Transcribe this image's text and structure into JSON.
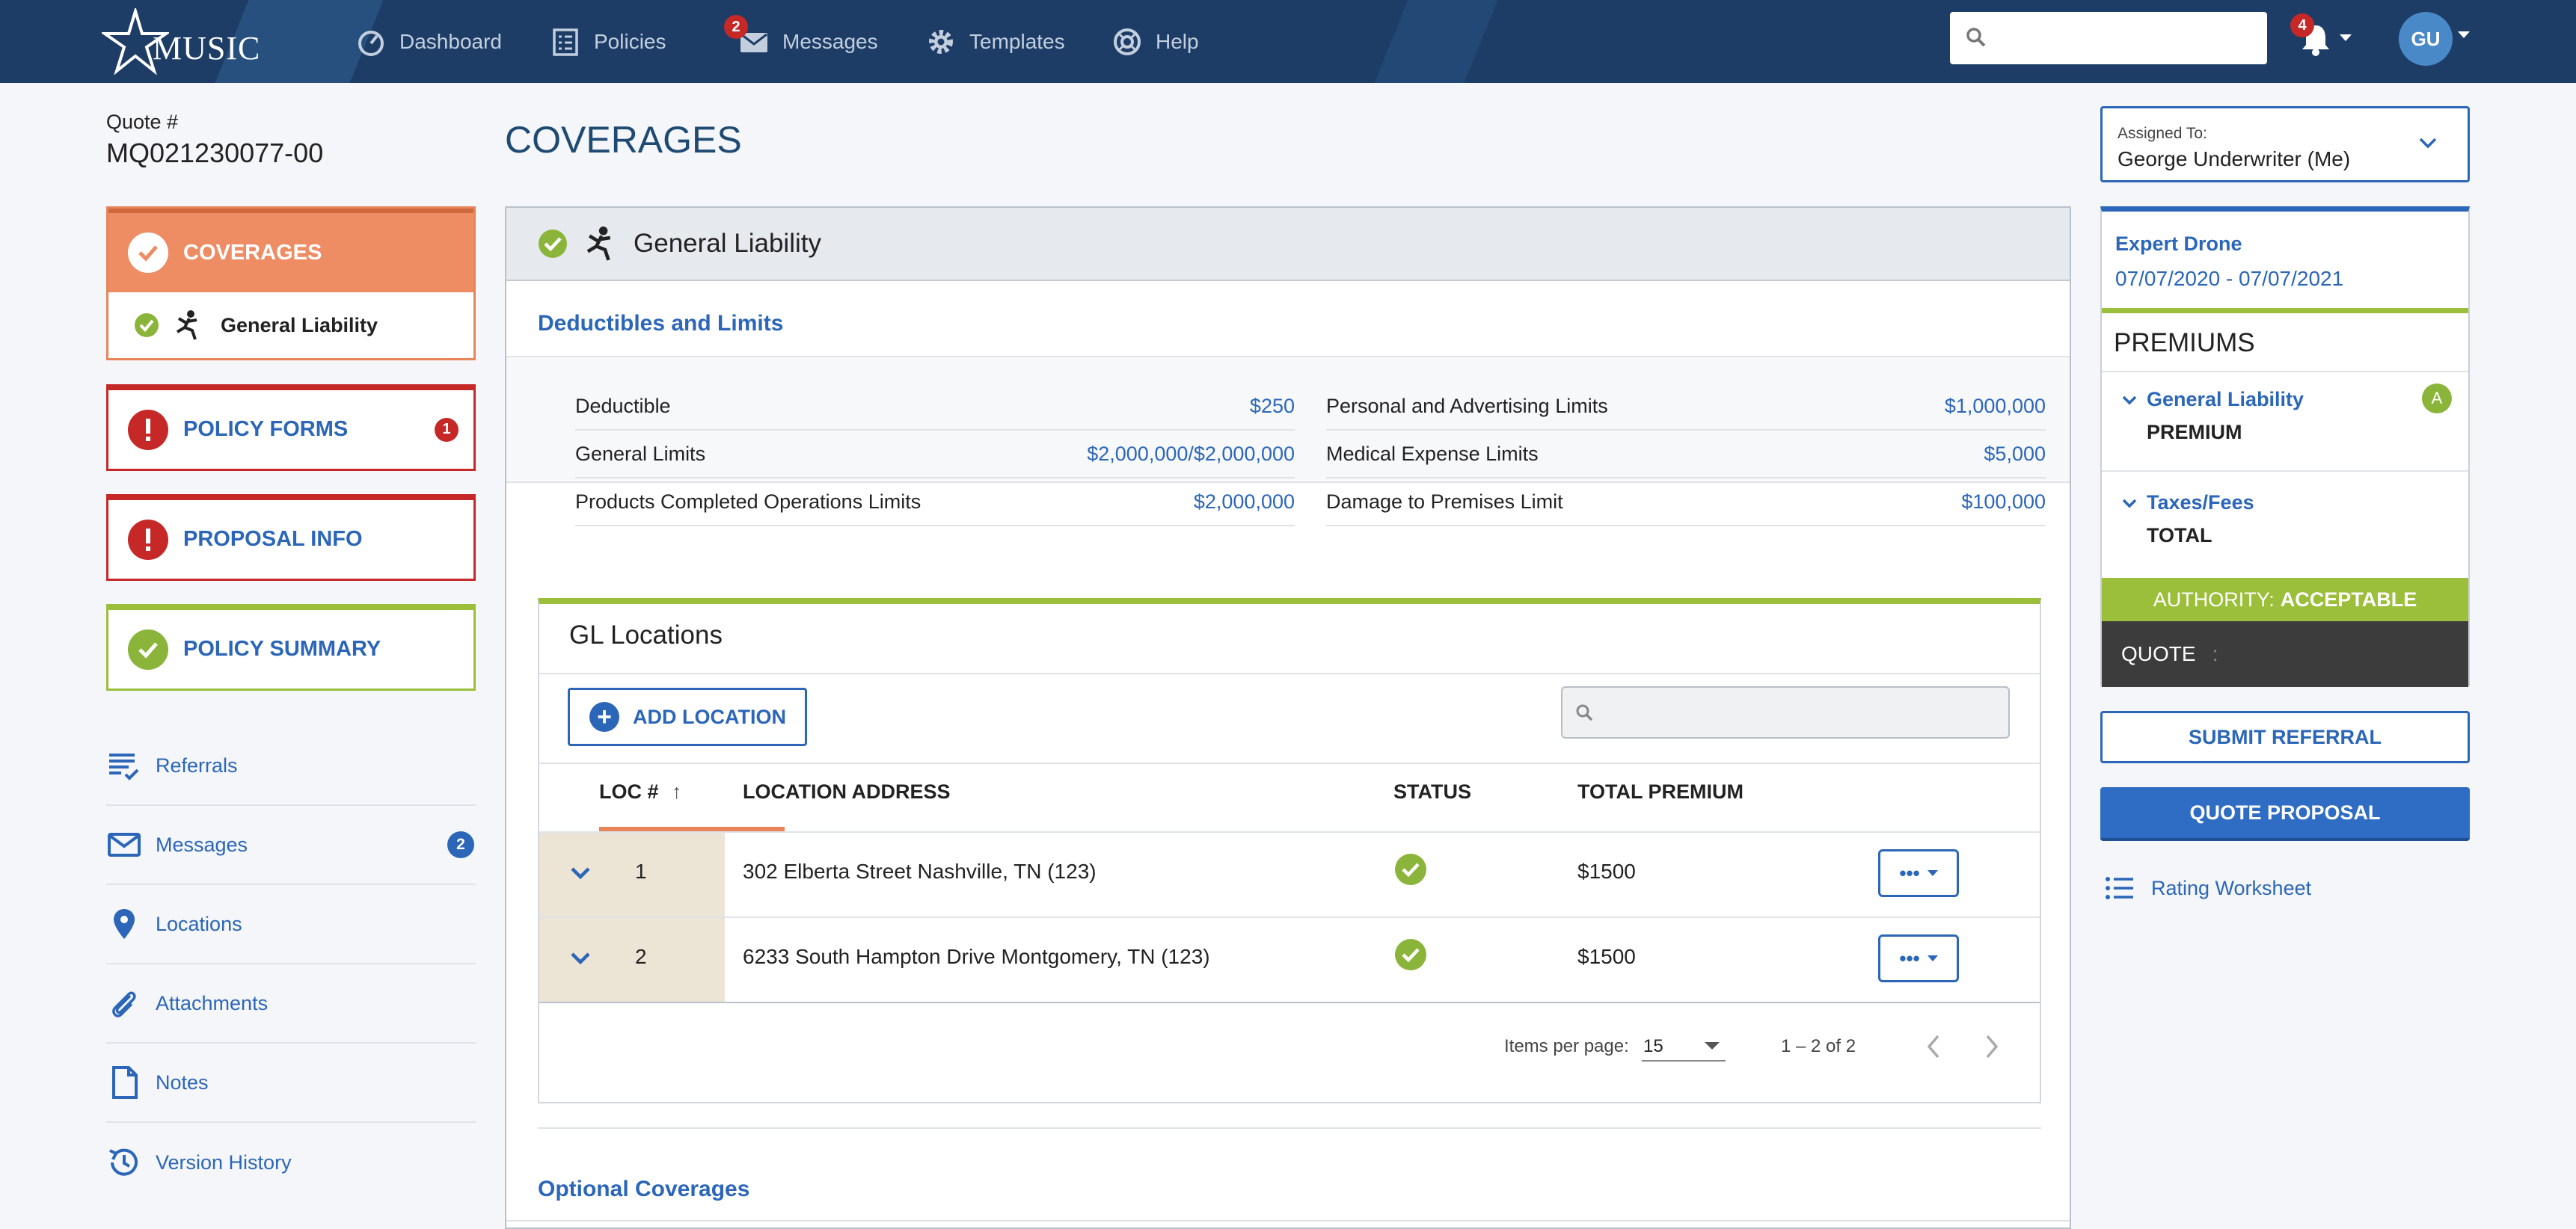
{
  "nav": {
    "logo": "MUSIC",
    "items": [
      {
        "label": "Dashboard",
        "icon": "dashboard-icon"
      },
      {
        "label": "Policies",
        "icon": "policies-icon"
      },
      {
        "label": "Messages",
        "icon": "messages-icon",
        "badge": "2"
      },
      {
        "label": "Templates",
        "icon": "gear-icon"
      },
      {
        "label": "Help",
        "icon": "help-icon"
      }
    ],
    "search_placeholder": "",
    "notification_count": "4",
    "user_initials": "GU"
  },
  "quote": {
    "label": "Quote #",
    "number": "MQ021230077-00"
  },
  "sidebar": {
    "coverages": {
      "label": "COVERAGES",
      "sub_label": "General Liability"
    },
    "policy_forms": {
      "label": "POLICY FORMS",
      "badge": "1"
    },
    "proposal_info": {
      "label": "PROPOSAL INFO"
    },
    "policy_summary": {
      "label": "POLICY SUMMARY"
    },
    "links": [
      {
        "label": "Referrals",
        "icon": "referrals-icon"
      },
      {
        "label": "Messages",
        "icon": "mail-icon",
        "badge": "2"
      },
      {
        "label": "Locations",
        "icon": "location-pin-icon"
      },
      {
        "label": "Attachments",
        "icon": "paperclip-icon"
      },
      {
        "label": "Notes",
        "icon": "document-icon"
      },
      {
        "label": "Version History",
        "icon": "history-icon"
      }
    ]
  },
  "main": {
    "title": "COVERAGES",
    "coverage_name": "General Liability",
    "deductibles_title": "Deductibles and Limits",
    "deductibles_left": [
      {
        "label": "Deductible",
        "value": "$250"
      },
      {
        "label": "General Limits",
        "value": "$2,000,000/$2,000,000"
      },
      {
        "label": "Products Completed Operations Limits",
        "value": "$2,000,000"
      }
    ],
    "deductibles_right": [
      {
        "label": "Personal and Advertising Limits",
        "value": "$1,000,000"
      },
      {
        "label": "Medical Expense Limits",
        "value": "$5,000"
      },
      {
        "label": "Damage to Premises Limit",
        "value": "$100,000"
      }
    ],
    "locations": {
      "title": "GL Locations",
      "add_button": "ADD LOCATION",
      "search_placeholder": "",
      "columns": [
        "LOC #",
        "LOCATION ADDRESS",
        "STATUS",
        "TOTAL PREMIUM"
      ],
      "rows": [
        {
          "loc": "1",
          "address": "302 Elberta Street Nashville, TN (123)",
          "status": "ok",
          "premium": "$1500"
        },
        {
          "loc": "2",
          "address": "6233 South Hampton Drive Montgomery, TN (123)",
          "status": "ok",
          "premium": "$1500"
        }
      ],
      "items_per_page_label": "Items per page:",
      "items_per_page": "15",
      "range": "1 – 2 of 2",
      "more_label": "•••"
    },
    "optional_title": "Optional Coverages"
  },
  "right": {
    "assigned_label": "Assigned To:",
    "assigned_value": "George Underwriter (Me)",
    "insured_name": "Expert Drone",
    "policy_period": "07/07/2020 - 07/07/2021",
    "premiums_title": "PREMIUMS",
    "premium_items": [
      {
        "label": "General Liability",
        "sub": "PREMIUM",
        "badge": "A"
      },
      {
        "label": "Taxes/Fees",
        "sub": "TOTAL"
      }
    ],
    "authority_label": "AUTHORITY:",
    "authority_value": "ACCEPTABLE",
    "quote_label": "QUOTE",
    "quote_suffix": ":",
    "submit_referral": "SUBMIT REFERRAL",
    "quote_proposal": "QUOTE PROPOSAL",
    "rating_worksheet": "Rating Worksheet"
  },
  "colors": {
    "nav_bg": "#1d3d66",
    "accent_blue": "#2b66b8",
    "error_red": "#c62828",
    "success_green": "#8bb53a",
    "coverage_orange": "#ee8c64"
  }
}
